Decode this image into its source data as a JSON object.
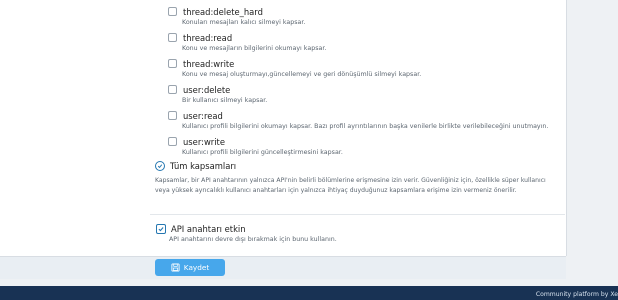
{
  "scopes": [
    {
      "name": "thread:delete_hard",
      "desc": "Konuları mesajları kalıcı silmeyi kapsar."
    },
    {
      "name": "thread:read",
      "desc": "Konu ve mesajların bilgilerini okumayı kapsar."
    },
    {
      "name": "thread:write",
      "desc": "Konu ve mesaj oluşturmayı,güncellemeyi ve geri dönüşümlü silmeyi kapsar."
    },
    {
      "name": "user:delete",
      "desc": "Bir kullanıcı silmeyi kapsar."
    },
    {
      "name": "user:read",
      "desc": "Kullanıcı profili bilgilerini okumayı kapsar. Bazı profil ayrıntılarının başka venilerle birlikte verilebileceğini unutmayın."
    },
    {
      "name": "user:write",
      "desc": "Kullanıcı profili bilgilerini güncelleştirmesini kapsar."
    }
  ],
  "all_scopes": {
    "label": "Tüm kapsamları",
    "explain": "Kapsamlar, bir API anahtarının yalnızca API'nin belirli bölümlerine erişmesine izin verir. Güvenliğiniz için, özellikle süper kullanıcı veya yüksek ayrıcalıklı kullanıcı anahtarları için yalnızca ihtiyaç duyduğunuz kapsamlara erişime izin vermeniz önerilir."
  },
  "active": {
    "label": "API anahtarı etkin",
    "desc": "API anahtarını devre dışı bırakmak için bunu kullanın.",
    "checked": true
  },
  "save_label": "Kaydet",
  "footer_text": "Community platform by Xe",
  "colors": {
    "accent": "#47a7eb",
    "footer": "#183254"
  }
}
